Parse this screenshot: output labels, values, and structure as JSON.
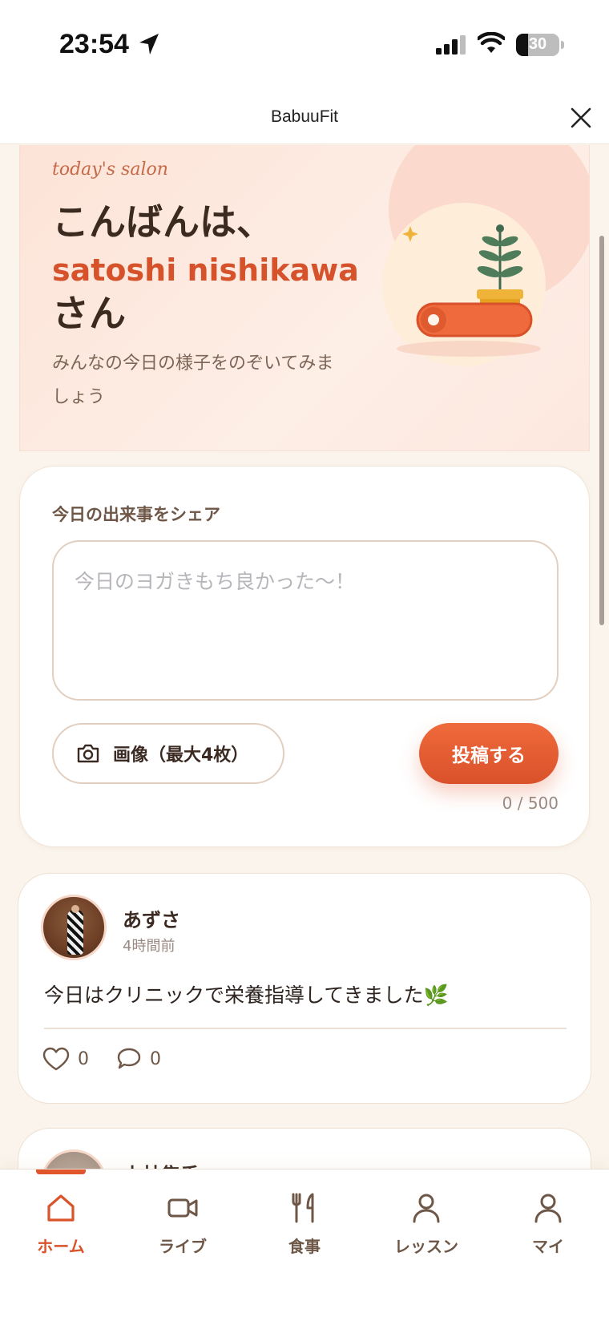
{
  "status_bar": {
    "time": "23:54",
    "battery": "30"
  },
  "header": {
    "title": "BabuuFit"
  },
  "hero": {
    "tag": "today's salon",
    "greeting": "こんばんは、",
    "user_name": "satoshi nishikawa",
    "honorific": "さん",
    "subtitle": "みんなの今日の様子をのぞいてみましょう"
  },
  "compose": {
    "label": "今日の出来事をシェア",
    "placeholder": "今日のヨガきもち良かった〜！",
    "value": "",
    "image_button": "画像（最大4枚）",
    "post_button": "投稿する",
    "char_count": "0 / 500"
  },
  "posts": [
    {
      "user": "あずさ",
      "time": "4時間前",
      "body": "今日はクリニックで栄養指導してきました🌿",
      "likes": "0",
      "comments": "0"
    },
    {
      "user": "小林隼香"
    }
  ],
  "tabs": [
    {
      "label": "ホーム",
      "icon": "home-icon",
      "active": true
    },
    {
      "label": "ライブ",
      "icon": "video-icon"
    },
    {
      "label": "食事",
      "icon": "cutlery-icon"
    },
    {
      "label": "レッスン",
      "icon": "person-icon"
    },
    {
      "label": "マイ",
      "icon": "person-icon"
    }
  ],
  "colors": {
    "accent": "#e0552c",
    "background": "#faf4ec",
    "hero_bg": "#fde3d7"
  }
}
